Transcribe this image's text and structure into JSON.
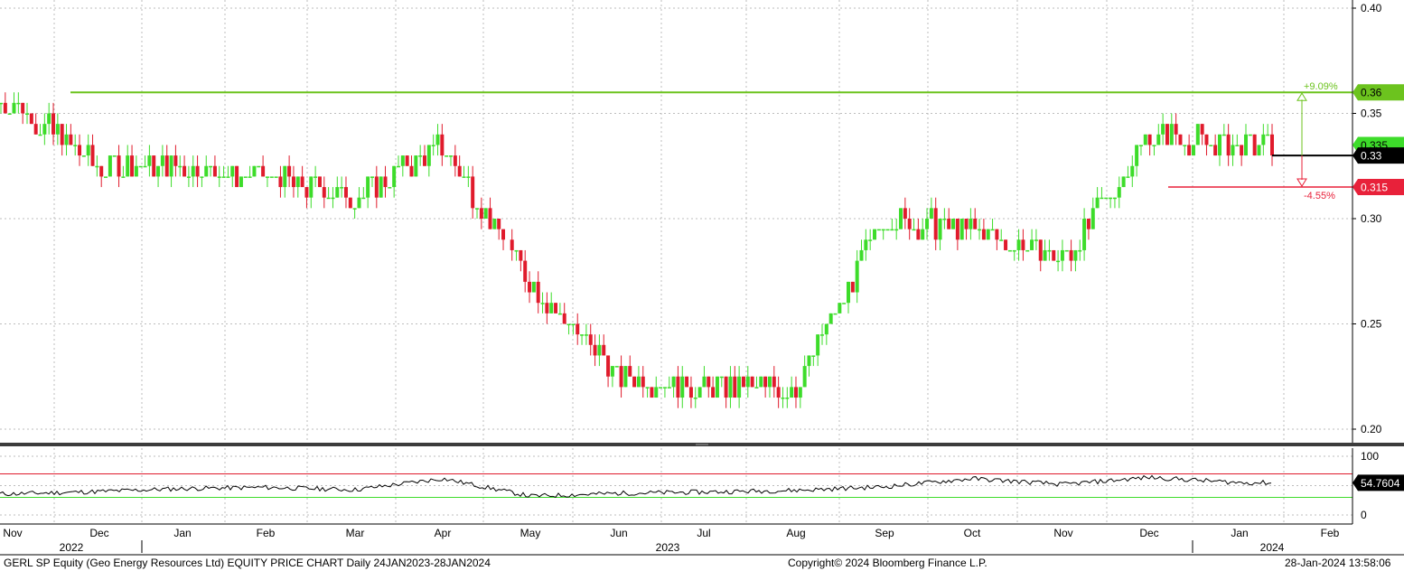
{
  "chart_data": {
    "type": "candlestick",
    "security": "GERL SP Equity (Geo Energy Resources Ltd) EQUITY PRICE CHART",
    "frequency": "Daily",
    "date_range": "24JAN2023-28JAN2024",
    "y_ticks": [
      "0.40",
      "0.35",
      "0.30",
      "0.25",
      "0.20"
    ],
    "ylim": [
      0.198,
      0.402
    ],
    "x_month_labels": [
      "Nov",
      "Dec",
      "Jan",
      "Feb",
      "Mar",
      "Apr",
      "May",
      "Jun",
      "Jul",
      "Aug",
      "Sep",
      "Oct",
      "Nov",
      "Dec",
      "Jan",
      "Feb"
    ],
    "x_year_labels": [
      "2022",
      "2023",
      "2024"
    ],
    "price_series": [
      {
        "month": "Nov 2022",
        "high": 0.385,
        "low": 0.35,
        "close": 0.355
      },
      {
        "month": "Dec 2022",
        "high": 0.357,
        "low": 0.305,
        "close": 0.325
      },
      {
        "month": "Jan 2023",
        "high": 0.345,
        "low": 0.315,
        "close": 0.325
      },
      {
        "month": "Feb 2023",
        "high": 0.34,
        "low": 0.3,
        "close": 0.32
      },
      {
        "month": "Mar 2023",
        "high": 0.325,
        "low": 0.285,
        "close": 0.31
      },
      {
        "month": "Apr 2023",
        "high": 0.345,
        "low": 0.325,
        "close": 0.335
      },
      {
        "month": "May 2023",
        "high": 0.305,
        "low": 0.265,
        "close": 0.27
      },
      {
        "month": "Jun 2023",
        "high": 0.265,
        "low": 0.215,
        "close": 0.225
      },
      {
        "month": "Jul 2023",
        "high": 0.23,
        "low": 0.212,
        "close": 0.22
      },
      {
        "month": "Aug 2023",
        "high": 0.23,
        "low": 0.21,
        "close": 0.22
      },
      {
        "month": "Sep 2023",
        "high": 0.31,
        "low": 0.22,
        "close": 0.3
      },
      {
        "month": "Oct 2023",
        "high": 0.311,
        "low": 0.285,
        "close": 0.295
      },
      {
        "month": "Nov 2023",
        "high": 0.295,
        "low": 0.275,
        "close": 0.28
      },
      {
        "month": "Dec 2023",
        "high": 0.35,
        "low": 0.275,
        "close": 0.34
      },
      {
        "month": "Jan 2024",
        "high": 0.345,
        "low": 0.33,
        "close": 0.335
      }
    ],
    "last_price": "0.335",
    "reference_price": "0.33",
    "upper_target": {
      "price": "0.36",
      "label": "+9.09%",
      "color": "#6cc31e"
    },
    "lower_target": {
      "price": "0.315",
      "label": "-4.55%",
      "color": "#e8213a"
    },
    "rsi": {
      "y_ticks": [
        "100",
        "0"
      ],
      "upper_band": 70,
      "lower_band": 30,
      "last_value": "54.7604",
      "series_by_month": [
        {
          "month": "Nov 2022",
          "value": 36
        },
        {
          "month": "Dec 2022",
          "value": 40
        },
        {
          "month": "Jan 2023",
          "value": 45
        },
        {
          "month": "Feb 2023",
          "value": 47
        },
        {
          "month": "Mar 2023",
          "value": 43
        },
        {
          "month": "Apr 2023",
          "value": 62
        },
        {
          "month": "May 2023",
          "value": 32
        },
        {
          "month": "Jun 2023",
          "value": 37
        },
        {
          "month": "Jul 2023",
          "value": 39
        },
        {
          "month": "Aug 2023",
          "value": 42
        },
        {
          "month": "Sep 2023",
          "value": 48
        },
        {
          "month": "Oct 2023",
          "value": 62
        },
        {
          "month": "Nov 2023",
          "value": 52
        },
        {
          "month": "Dec 2023",
          "value": 64
        },
        {
          "month": "Jan 2024",
          "value": 55
        }
      ]
    },
    "colors": {
      "up": "#3ddc2a",
      "down": "#e01b2c",
      "grid": "#bdbdbd",
      "separator": "#3c3c3c"
    },
    "grid": true
  },
  "footer": {
    "title": "GERL SP Equity (Geo Energy Resources Ltd) EQUITY PRICE CHART  Daily 24JAN2023-28JAN2024",
    "copyright": "Copyright© 2024 Bloomberg Finance L.P.",
    "timestamp": "28-Jan-2024 13:58:06"
  }
}
